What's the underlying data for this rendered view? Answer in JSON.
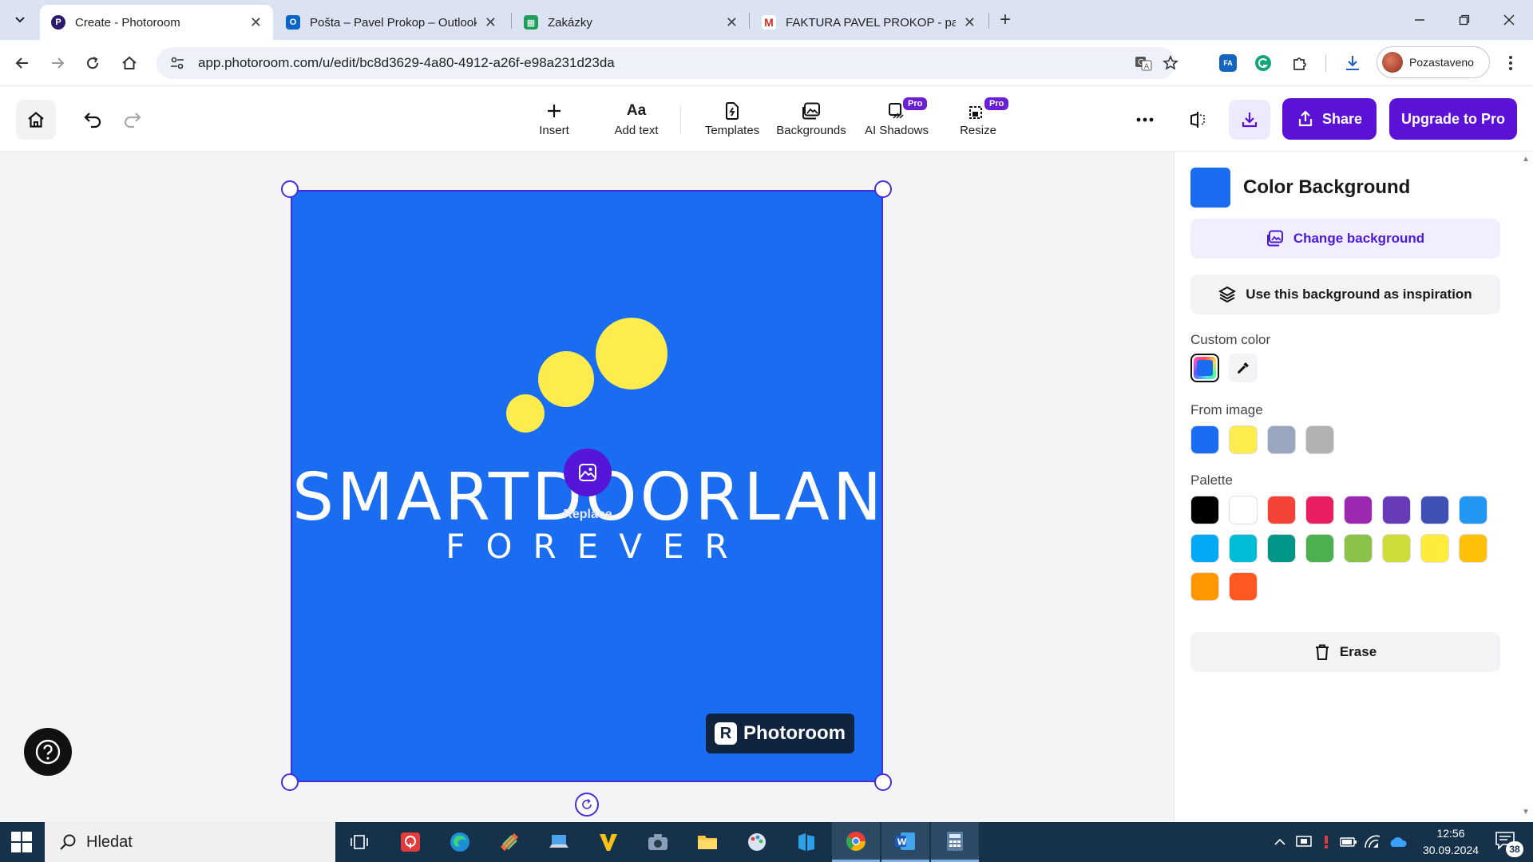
{
  "browser": {
    "tabs": [
      {
        "title": "Create - Photoroom",
        "favicon": "photoroom-favicon",
        "active": true
      },
      {
        "title": "Pošta – Pavel Prokop – Outlook",
        "favicon": "outlook-favicon",
        "active": false
      },
      {
        "title": "Zakázky",
        "favicon": "sheets-favicon",
        "active": false
      },
      {
        "title": "FAKTURA PAVEL PROKOP - pav",
        "favicon": "gmail-favicon",
        "active": false
      }
    ],
    "url": "app.photoroom.com/u/edit/bc8d3629-4a80-4912-a26f-e98a231d23da",
    "profile_label": "Pozastaveno",
    "ext_fa_label": "FA"
  },
  "toolbar": {
    "tools": [
      {
        "label": "Insert",
        "icon": "plus-icon"
      },
      {
        "label": "Add text",
        "icon": "text-icon",
        "glyph": "Aa"
      },
      {
        "label": "Templates",
        "icon": "templates-icon"
      },
      {
        "label": "Backgrounds",
        "icon": "backgrounds-icon"
      },
      {
        "label": "AI Shadows",
        "icon": "shadow-icon",
        "badge": "Pro"
      },
      {
        "label": "Resize",
        "icon": "resize-icon",
        "badge": "Pro"
      }
    ],
    "share_label": "Share",
    "upgrade_label": "Upgrade to Pro"
  },
  "canvas": {
    "background_color": "#1a6cf0",
    "logo_main": "SMARTDOORLAND",
    "logo_sub": "FOREVER",
    "replace_label": "Replace",
    "watermark": "Photoroom",
    "watermark_glyph": "R"
  },
  "panel": {
    "title": "Color Background",
    "change_background_label": "Change background",
    "inspiration_label": "Use this background as inspiration",
    "custom_color_label": "Custom color",
    "from_image_label": "From image",
    "from_image_colors": [
      "#1a6cf0",
      "#fdec4e",
      "#98a6bf",
      "#b1b1b1"
    ],
    "palette_label": "Palette",
    "palette_colors": [
      "#000000",
      "#ffffff",
      "#f44336",
      "#e91e63",
      "#9c27b0",
      "#673ab7",
      "#3f51b5",
      "#2196f3",
      "#03a9f4",
      "#00bcd4",
      "#009688",
      "#4caf50",
      "#8bc34a",
      "#cddc39",
      "#ffeb3b",
      "#ffc107",
      "#ff9800",
      "#ff5722"
    ],
    "erase_label": "Erase"
  },
  "taskbar": {
    "search_placeholder": "Hledat",
    "time": "12:56",
    "date": "30.09.2024",
    "notification_count": "38"
  }
}
